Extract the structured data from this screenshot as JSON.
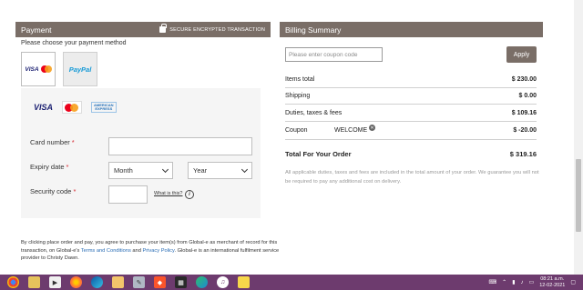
{
  "payment": {
    "title": "Payment",
    "secure_label": "SECURE ENCRYPTED TRANSACTION",
    "choose_label": "Please choose your payment method",
    "methods": [
      {
        "visa": "VISA",
        "selected": true
      },
      {
        "label": "PayPal",
        "selected": false
      }
    ],
    "logos": {
      "visa": "VISA",
      "amex_line1": "AMERICAN",
      "amex_line2": "EXPRESS"
    },
    "fields": {
      "card_number_label": "Card number",
      "expiry_label": "Expiry date",
      "month_value": "Month",
      "year_value": "Year",
      "security_label": "Security code",
      "what_is_this": "What is this?",
      "required_mark": "*"
    },
    "legal": {
      "part1": "By clicking place order and pay, you agree to purchase your item(s) from Global-e as merchant of record for this transaction, on Global-e's ",
      "terms": "Terms and Conditions",
      "and": " and ",
      "privacy": "Privacy Policy",
      "part2": ". Global-e is an international fulfilment service provider to Christy Dawn."
    }
  },
  "billing": {
    "title": "Billing Summary",
    "coupon_placeholder": "Please enter coupon code",
    "apply_label": "Apply",
    "items_total_label": "Items total",
    "items_total": "$ 230.00",
    "shipping_label": "Shipping",
    "shipping": "$ 0.00",
    "duties_label": "Duties, taxes & fees",
    "duties": "$ 109.16",
    "coupon_label": "Coupon",
    "coupon_code": "WELCOME",
    "coupon_amount": "$ -20.00",
    "total_label": "Total For Your Order",
    "total": "$ 319.16",
    "note": "All applicable duties, taxes and fees are included in the total amount of your order. We guarantee you will not be required to pay any additional cost on delivery."
  },
  "taskbar": {
    "time": "08:21 a.m.",
    "date": "12-02-2021",
    "apps": [
      "chrome-icon",
      "files-icon",
      "media-icon",
      "firefox-icon",
      "edge-icon",
      "folder-icon",
      "tools-icon",
      "brave-icon",
      "windows-store-icon",
      "browser-icon",
      "music-icon",
      "notes-icon"
    ]
  },
  "colors": {
    "header": "#7a6e67",
    "taskbar": "#6d3b6e",
    "required": "#d7262f",
    "link": "#2a6db5"
  }
}
